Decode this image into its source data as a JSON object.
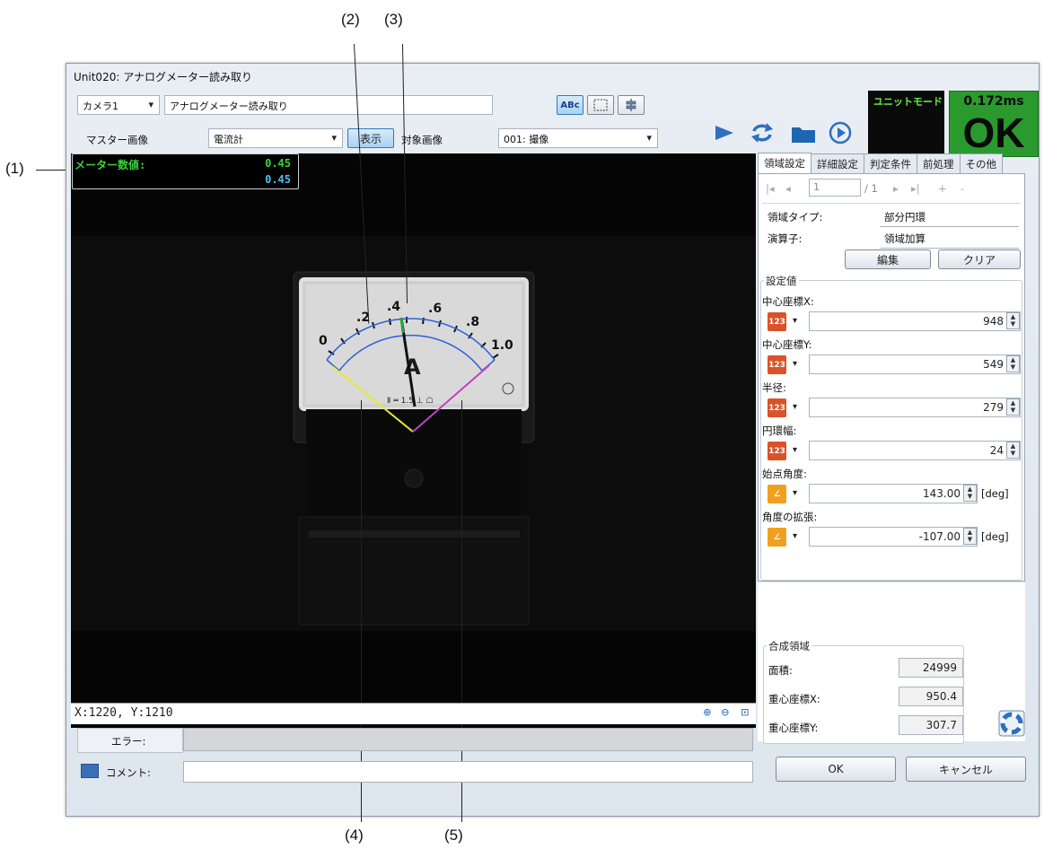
{
  "callouts": {
    "c1": "(1)",
    "c2": "(2)",
    "c3": "(3)",
    "c4": "(4)",
    "c5": "(5)"
  },
  "window": {
    "title": "Unit020: アナログメーター読み取り"
  },
  "toolbar": {
    "camera_select": "カメラ1",
    "unit_name": "アナログメーター読み取り",
    "master_label": "マスター画像",
    "master_select": "電流計",
    "show_button": "表示",
    "target_label": "対象画像",
    "target_select": "001: 撮像",
    "abc_button": "ABc"
  },
  "status": {
    "mode_label": "ユニットモード",
    "time": "0.172ms",
    "result": "OK"
  },
  "image": {
    "readout_label": "メーター数値:",
    "readout_value1": "0.45",
    "readout_value2": "0.45",
    "meter_scale": [
      "0",
      ".2",
      ".4",
      ".6",
      ".8",
      "1.0"
    ],
    "meter_unit": "A",
    "meter_footer": "Ⅱ ═ 1.5 ⊥ ☖",
    "coords": "X:1220, Y:1210"
  },
  "panel": {
    "tabs": [
      "領域設定",
      "詳細設定",
      "判定条件",
      "前処理",
      "その他"
    ],
    "nav_current": "1",
    "nav_total": "/ 1",
    "region_type_label": "領域タイプ:",
    "region_type_value": "部分円環",
    "operator_label": "演算子:",
    "operator_value": "領域加算",
    "edit_button": "編集",
    "clear_button": "クリア",
    "settings_group": "設定値",
    "params": [
      {
        "label": "中心座標X:",
        "value": "948",
        "icon": "123-icon",
        "unit": ""
      },
      {
        "label": "中心座標Y:",
        "value": "549",
        "icon": "123-icon",
        "unit": ""
      },
      {
        "label": "半径:",
        "value": "279",
        "icon": "123-icon",
        "unit": ""
      },
      {
        "label": "円環幅:",
        "value": "24",
        "icon": "123-icon",
        "unit": ""
      },
      {
        "label": "始点角度:",
        "value": "143.00",
        "icon": "angle-icon",
        "unit": "[deg]"
      },
      {
        "label": "角度の拡張:",
        "value": "-107.00",
        "icon": "angle-icon",
        "unit": "[deg]"
      }
    ],
    "composite_group": "合成領域",
    "area_label": "面積:",
    "area_value": "24999",
    "cgx_label": "重心座標X:",
    "cgx_value": "950.4",
    "cgy_label": "重心座標Y:",
    "cgy_value": "307.7"
  },
  "bottom": {
    "error_label": "エラー:",
    "comment_label": "コメント:",
    "ok_button": "OK",
    "cancel_button": "キャンセル"
  },
  "colors": {
    "ok_green": "#2a9a2e",
    "readout_green": "#39d339",
    "readout_blue": "#4ec0f0",
    "region_blue": "#2f5fd8",
    "line_yellow": "#e8e832",
    "line_magenta": "#c040c8"
  }
}
